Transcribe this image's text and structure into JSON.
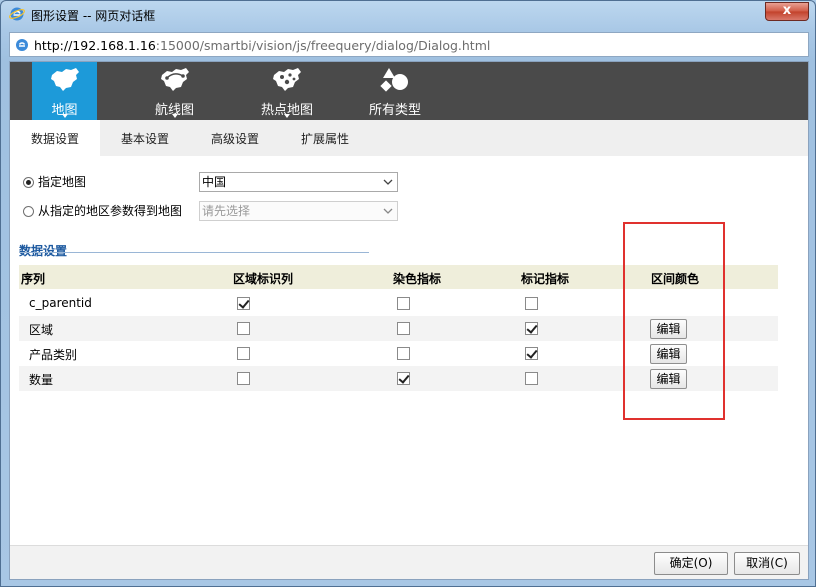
{
  "window": {
    "title": "图形设置 -- 网页对话框",
    "close_label": "x",
    "url_host": "http://192.168.1.16",
    "url_rest": ":15000/smartbi/vision/js/freequery/dialog/Dialog.html"
  },
  "chart_types": [
    {
      "label": "地图",
      "icon": "china-map-icon",
      "active": true
    },
    {
      "label": "航线图",
      "icon": "route-map-icon",
      "active": false
    },
    {
      "label": "热点地图",
      "icon": "heat-map-icon",
      "active": false
    },
    {
      "label": "所有类型",
      "icon": "all-types-icon",
      "active": false
    }
  ],
  "tabs": [
    "数据设置",
    "基本设置",
    "高级设置",
    "扩展属性"
  ],
  "map_source": {
    "option1_label": "指定地图",
    "option1_value": "中国",
    "option2_label": "从指定的地区参数得到地图",
    "option2_placeholder": "请先选择"
  },
  "section": {
    "title": "数据设置"
  },
  "grid": {
    "headers": [
      "序列",
      "区域标识列",
      "染色指标",
      "标记指标",
      "区间颜色"
    ],
    "rows": [
      {
        "name": "c_parentid",
        "region": true,
        "color": false,
        "marker": false,
        "has_edit": false
      },
      {
        "name": "区域",
        "region": false,
        "color": false,
        "marker": true,
        "has_edit": true
      },
      {
        "name": "产品类别",
        "region": false,
        "color": false,
        "marker": true,
        "has_edit": true
      },
      {
        "name": "数量",
        "region": false,
        "color": true,
        "marker": false,
        "has_edit": true
      }
    ],
    "edit_label": "编辑"
  },
  "footer": {
    "ok_label": "确定(O)",
    "cancel_label": "取消(C)"
  },
  "colors": {
    "accent": "#1d9ad9",
    "toolbar": "#4a4a4a",
    "highlight": "#e0312e"
  }
}
